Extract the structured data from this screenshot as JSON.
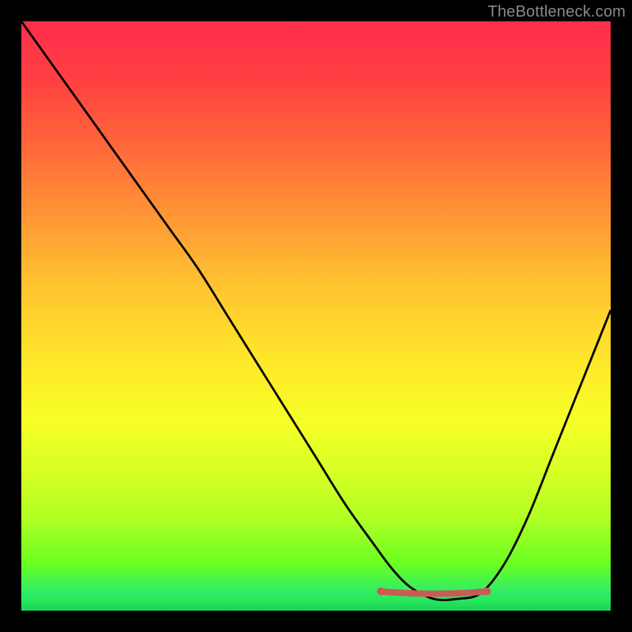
{
  "watermark": "TheBottleneck.com",
  "chart_data": {
    "type": "line",
    "title": "",
    "xlabel": "",
    "ylabel": "",
    "xlim": [
      0,
      100
    ],
    "ylim": [
      0,
      100
    ],
    "grid": false,
    "legend": false,
    "series": [
      {
        "name": "bottleneck-curve",
        "x": [
          0,
          5,
          10,
          15,
          20,
          25,
          30,
          35,
          40,
          45,
          50,
          55,
          60,
          63,
          66,
          70,
          74,
          78,
          82,
          86,
          90,
          94,
          98,
          100
        ],
        "y": [
          100,
          93,
          86,
          79,
          72,
          65,
          58,
          50,
          42,
          34,
          26,
          18,
          11,
          7,
          4,
          2,
          2,
          3,
          8,
          16,
          26,
          36,
          46,
          51
        ]
      }
    ],
    "optimal_region": {
      "name": "optimal-range-marker",
      "x": [
        61,
        79
      ],
      "y": [
        3,
        3
      ]
    },
    "background_gradient_stops": [
      {
        "t": 0.0,
        "color": "#ff2d4d"
      },
      {
        "t": 0.5,
        "color": "#ffe82a"
      },
      {
        "t": 0.82,
        "color": "#b3ff23"
      },
      {
        "t": 1.0,
        "color": "#19cf5b"
      }
    ]
  }
}
